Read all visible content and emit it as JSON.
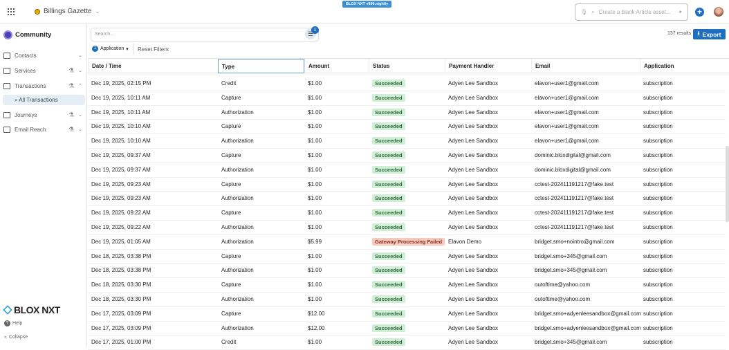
{
  "topbar": {
    "publication": "Billings Gazette",
    "version": "BLOX NXT v999.nightly",
    "command_placeholder": "Create a blank Article asset..."
  },
  "sidebar": {
    "title": "Community",
    "items": [
      {
        "label": "Contacts"
      },
      {
        "label": "Services"
      },
      {
        "label": "Transactions"
      },
      {
        "label": "Journeys"
      },
      {
        "label": "Email Reach"
      }
    ],
    "sub_item": "All Transactions",
    "logo": "BLOX NXT",
    "help": "Help",
    "collapse": "Collapse"
  },
  "toolbar": {
    "search_placeholder": "Search...",
    "filter_count": "1",
    "chip_count": "1",
    "chip_label": "Application",
    "reset": "Reset Filters",
    "results": "137 results",
    "export": "Export"
  },
  "colors": {
    "accent": "#1f6fc0",
    "success_bg": "#cfeed5",
    "fail_bg": "#f6c9bd"
  },
  "table": {
    "headers": [
      "Date / Time",
      "Type",
      "Amount",
      "Status",
      "Payment Handler",
      "Email",
      "Application"
    ],
    "rows": [
      [
        "Dec 19, 2025, 02:15 PM",
        "Credit",
        "$1.00",
        "Succeeded",
        "Adyen Lee Sandbox",
        "elavon+user1@gmail.com",
        "subscription"
      ],
      [
        "Dec 19, 2025, 10:11 AM",
        "Capture",
        "$1.00",
        "Succeeded",
        "Adyen Lee Sandbox",
        "elavon+user1@gmail.com",
        "subscription"
      ],
      [
        "Dec 19, 2025, 10:11 AM",
        "Authorization",
        "$1.00",
        "Succeeded",
        "Adyen Lee Sandbox",
        "elavon+user1@gmail.com",
        "subscription"
      ],
      [
        "Dec 19, 2025, 10:10 AM",
        "Capture",
        "$1.00",
        "Succeeded",
        "Adyen Lee Sandbox",
        "elavon+user1@gmail.com",
        "subscription"
      ],
      [
        "Dec 19, 2025, 10:10 AM",
        "Authorization",
        "$1.00",
        "Succeeded",
        "Adyen Lee Sandbox",
        "elavon+user1@gmail.com",
        "subscription"
      ],
      [
        "Dec 19, 2025, 09:37 AM",
        "Capture",
        "$1.00",
        "Succeeded",
        "Adyen Lee Sandbox",
        "dominic.bloxdigital@gmail.com",
        "subscription"
      ],
      [
        "Dec 19, 2025, 09:37 AM",
        "Authorization",
        "$1.00",
        "Succeeded",
        "Adyen Lee Sandbox",
        "dominic.bloxdigital@gmail.com",
        "subscription"
      ],
      [
        "Dec 19, 2025, 09:23 AM",
        "Capture",
        "$1.00",
        "Succeeded",
        "Adyen Lee Sandbox",
        "cctest-202411191217@fake.test",
        "subscription"
      ],
      [
        "Dec 19, 2025, 09:23 AM",
        "Authorization",
        "$1.00",
        "Succeeded",
        "Adyen Lee Sandbox",
        "cctest-202411191217@fake.test",
        "subscription"
      ],
      [
        "Dec 19, 2025, 09:22 AM",
        "Capture",
        "$1.00",
        "Succeeded",
        "Adyen Lee Sandbox",
        "cctest-202411191217@fake.test",
        "subscription"
      ],
      [
        "Dec 19, 2025, 09:22 AM",
        "Authorization",
        "$1.00",
        "Succeeded",
        "Adyen Lee Sandbox",
        "cctest-202411191217@fake.test",
        "subscription"
      ],
      [
        "Dec 19, 2025, 01:05 AM",
        "Authorization",
        "$5.99",
        "Gateway Processing Failed",
        "Elavon Demo",
        "bridget.smo+nointro@gmail.com",
        "subscription"
      ],
      [
        "Dec 18, 2025, 03:38 PM",
        "Capture",
        "$1.00",
        "Succeeded",
        "Adyen Lee Sandbox",
        "bridget.smo+345@gmail.com",
        "subscription"
      ],
      [
        "Dec 18, 2025, 03:38 PM",
        "Authorization",
        "$1.00",
        "Succeeded",
        "Adyen Lee Sandbox",
        "bridget.smo+345@gmail.com",
        "subscription"
      ],
      [
        "Dec 18, 2025, 03:30 PM",
        "Capture",
        "$1.00",
        "Succeeded",
        "Adyen Lee Sandbox",
        "outoftime@yahoo.com",
        "subscription"
      ],
      [
        "Dec 18, 2025, 03:30 PM",
        "Authorization",
        "$1.00",
        "Succeeded",
        "Adyen Lee Sandbox",
        "outoftime@yahoo.com",
        "subscription"
      ],
      [
        "Dec 17, 2025, 03:09 PM",
        "Capture",
        "$12.00",
        "Succeeded",
        "Adyen Lee Sandbox",
        "bridget.smo+adyenleesandbox@gmail.com",
        "subscription"
      ],
      [
        "Dec 17, 2025, 03:09 PM",
        "Authorization",
        "$12.00",
        "Succeeded",
        "Adyen Lee Sandbox",
        "bridget.smo+adyenleesandbox@gmail.com",
        "subscription"
      ],
      [
        "Dec 17, 2025, 01:00 PM",
        "Credit",
        "$1.00",
        "Succeeded",
        "Adyen Lee Sandbox",
        "bridget.smo+345@gmail.com",
        "subscription"
      ]
    ]
  }
}
